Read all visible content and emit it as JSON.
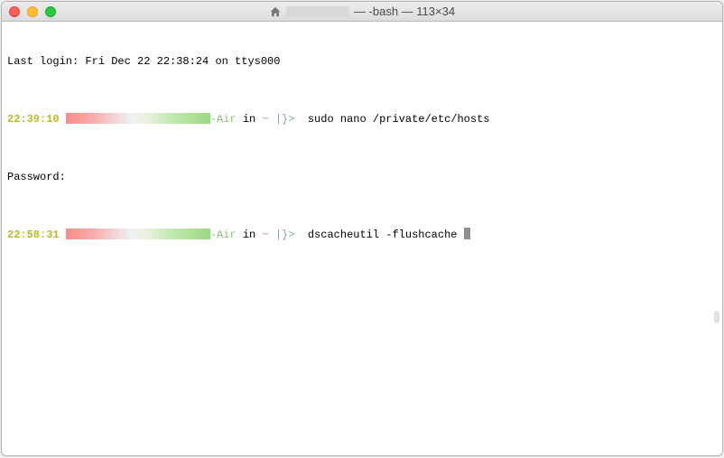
{
  "window": {
    "title_suffix": " — -bash — 113×34"
  },
  "terminal": {
    "last_login": "Last login: Fri Dec 22 22:38:24 on ttys000",
    "lines": [
      {
        "time": "22:39:10",
        "host_suffix": "-Air",
        "in": " in ",
        "path": "~",
        "sep": " |}> ",
        "command": " sudo nano /private/etc/hosts"
      }
    ],
    "password_prompt": "Password:",
    "current": {
      "time": "22:58:31",
      "host_suffix": "-Air",
      "in": " in ",
      "path": "~",
      "sep": " |}> ",
      "command": " dscacheutil -flushcache "
    }
  }
}
